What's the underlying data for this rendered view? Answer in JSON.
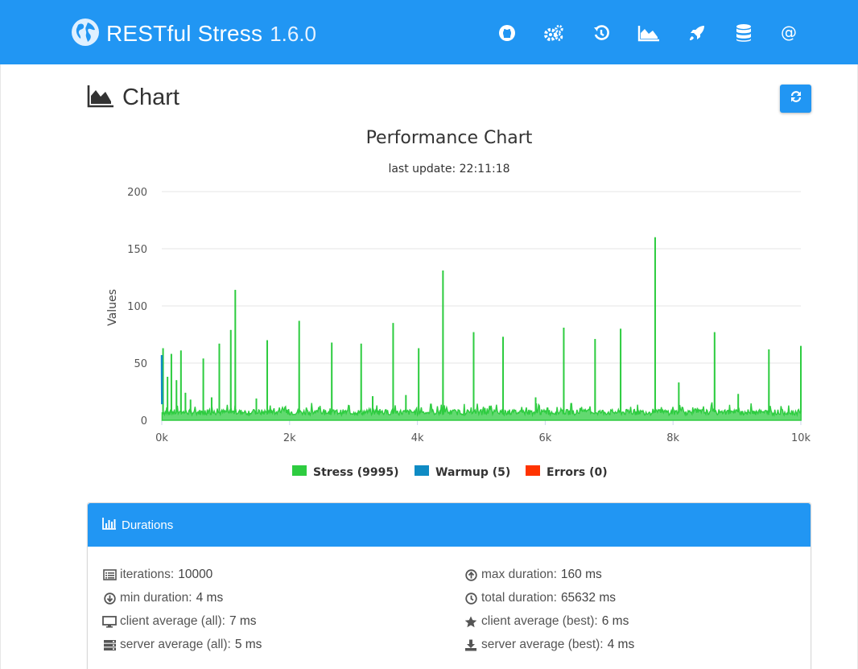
{
  "app": {
    "title": "RESTful Stress",
    "version": "1.6.0",
    "brand_color": "#2196f3"
  },
  "nav": {
    "items": [
      {
        "name": "github",
        "icon": "github-icon"
      },
      {
        "name": "settings",
        "icon": "gears-icon"
      },
      {
        "name": "history",
        "icon": "history-icon"
      },
      {
        "name": "chart",
        "icon": "area-chart-icon",
        "active": true
      },
      {
        "name": "launch",
        "icon": "rocket-icon"
      },
      {
        "name": "database",
        "icon": "database-icon"
      },
      {
        "name": "contact",
        "icon": "at-icon"
      }
    ]
  },
  "page": {
    "title": "Chart",
    "refresh_icon": "refresh-icon"
  },
  "chart_data": {
    "type": "area",
    "title": "Performance Chart",
    "subtitle": "last update: 22:11:18",
    "xlabel": "",
    "ylabel": "Values",
    "xlim": [
      0,
      10000
    ],
    "ylim": [
      0,
      200
    ],
    "x_ticks": [
      "0k",
      "2k",
      "4k",
      "6k",
      "8k",
      "10k"
    ],
    "y_ticks": [
      "0",
      "50",
      "100",
      "150",
      "200"
    ],
    "grid": true,
    "legend_position": "bottom",
    "series": [
      {
        "name": "Stress (9995)",
        "color": "#2ecc40",
        "baseline": 7,
        "x_range": [
          5,
          10000
        ],
        "spikes": [
          [
            20,
            63
          ],
          [
            90,
            38
          ],
          [
            150,
            58
          ],
          [
            230,
            35
          ],
          [
            300,
            61
          ],
          [
            370,
            24
          ],
          [
            450,
            18
          ],
          [
            650,
            54
          ],
          [
            780,
            20
          ],
          [
            900,
            67
          ],
          [
            1080,
            79
          ],
          [
            1150,
            114
          ],
          [
            1480,
            19
          ],
          [
            1650,
            70
          ],
          [
            2150,
            87
          ],
          [
            2660,
            68
          ],
          [
            3120,
            67
          ],
          [
            3300,
            21
          ],
          [
            3620,
            85
          ],
          [
            3820,
            22
          ],
          [
            4020,
            63
          ],
          [
            4400,
            131
          ],
          [
            4880,
            77
          ],
          [
            5340,
            73
          ],
          [
            5850,
            20
          ],
          [
            6290,
            81
          ],
          [
            6780,
            71
          ],
          [
            7180,
            80
          ],
          [
            7720,
            160
          ],
          [
            8090,
            33
          ],
          [
            8650,
            77
          ],
          [
            9020,
            23
          ],
          [
            9500,
            62
          ],
          [
            10000,
            65
          ]
        ]
      },
      {
        "name": "Warmup (5)",
        "color": "#0f8bc4",
        "values": [
          [
            0,
            57
          ],
          [
            1,
            40
          ],
          [
            2,
            28
          ],
          [
            3,
            20
          ],
          [
            4,
            14
          ]
        ]
      },
      {
        "name": "Errors (0)",
        "color": "#ff3300",
        "values": []
      }
    ]
  },
  "durations": {
    "heading": "Durations",
    "heading_icon": "bar-chart-icon",
    "left": [
      {
        "icon": "list-alt-icon",
        "label": "iterations:",
        "value": "10000"
      },
      {
        "icon": "arrow-circle-down-icon",
        "label": "min duration:",
        "value": "4 ms"
      },
      {
        "icon": "desktop-icon",
        "label": "client average (all):",
        "value": "7 ms"
      },
      {
        "icon": "server-icon",
        "label": "server average (all):",
        "value": "5 ms"
      }
    ],
    "right": [
      {
        "icon": "arrow-circle-up-icon",
        "label": "max duration:",
        "value": "160 ms"
      },
      {
        "icon": "clock-icon",
        "label": "total duration:",
        "value": "65632 ms"
      },
      {
        "icon": "star-icon",
        "label": "client average (best):",
        "value": "6 ms"
      },
      {
        "icon": "download-icon",
        "label": "server average (best):",
        "value": "4 ms"
      }
    ]
  }
}
